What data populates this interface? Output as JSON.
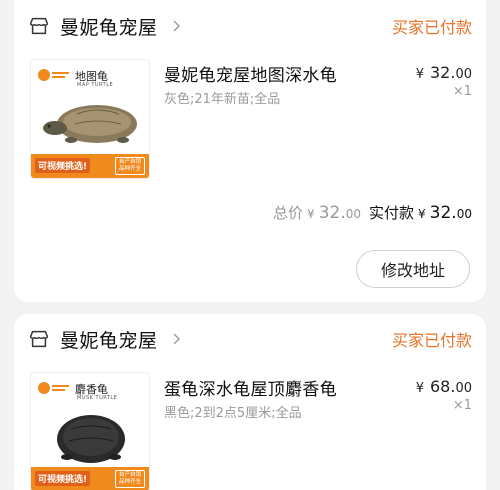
{
  "orders": [
    {
      "shop_name": "曼妮龟宠屋",
      "status": "买家已付款",
      "product": {
        "thumb_name": "地图龟",
        "thumb_en": "MAP TURTLE",
        "thumb_promo": "可视频挑选!",
        "thumb_badge_1": "自产自销",
        "thumb_badge_2": "品种齐全",
        "title": "曼妮龟宠屋地图深水龟",
        "spec": "灰色;21年新苗;全品",
        "price_currency": "¥",
        "price_int": "32.",
        "price_dec": "00",
        "quantity": "×1"
      },
      "totals": {
        "total_label": "总价",
        "total_currency": "¥",
        "total_int": "32.",
        "total_dec": "00",
        "paid_label": "实付款",
        "paid_currency": "¥",
        "paid_int": "32.",
        "paid_dec": "00"
      },
      "action_button": "修改地址"
    },
    {
      "shop_name": "曼妮龟宠屋",
      "status": "买家已付款",
      "product": {
        "thumb_name": "麝香龟",
        "thumb_en": "MUSK TURTLE",
        "thumb_promo": "可视频挑选!",
        "thumb_badge_1": "自产自销",
        "thumb_badge_2": "品种齐全",
        "title": "蛋龟深水龟屋顶麝香龟",
        "spec": "黑色;2到2点5厘米;全品",
        "price_currency": "¥",
        "price_int": "68.",
        "price_dec": "00",
        "quantity": "×1"
      }
    }
  ],
  "colors": {
    "status": "#e8732a",
    "thumb_band": "#f08a1c",
    "page_bg": "#f2f2f2"
  },
  "icons": {
    "shop": "shop-icon",
    "chevron": "chevron-right-icon"
  }
}
